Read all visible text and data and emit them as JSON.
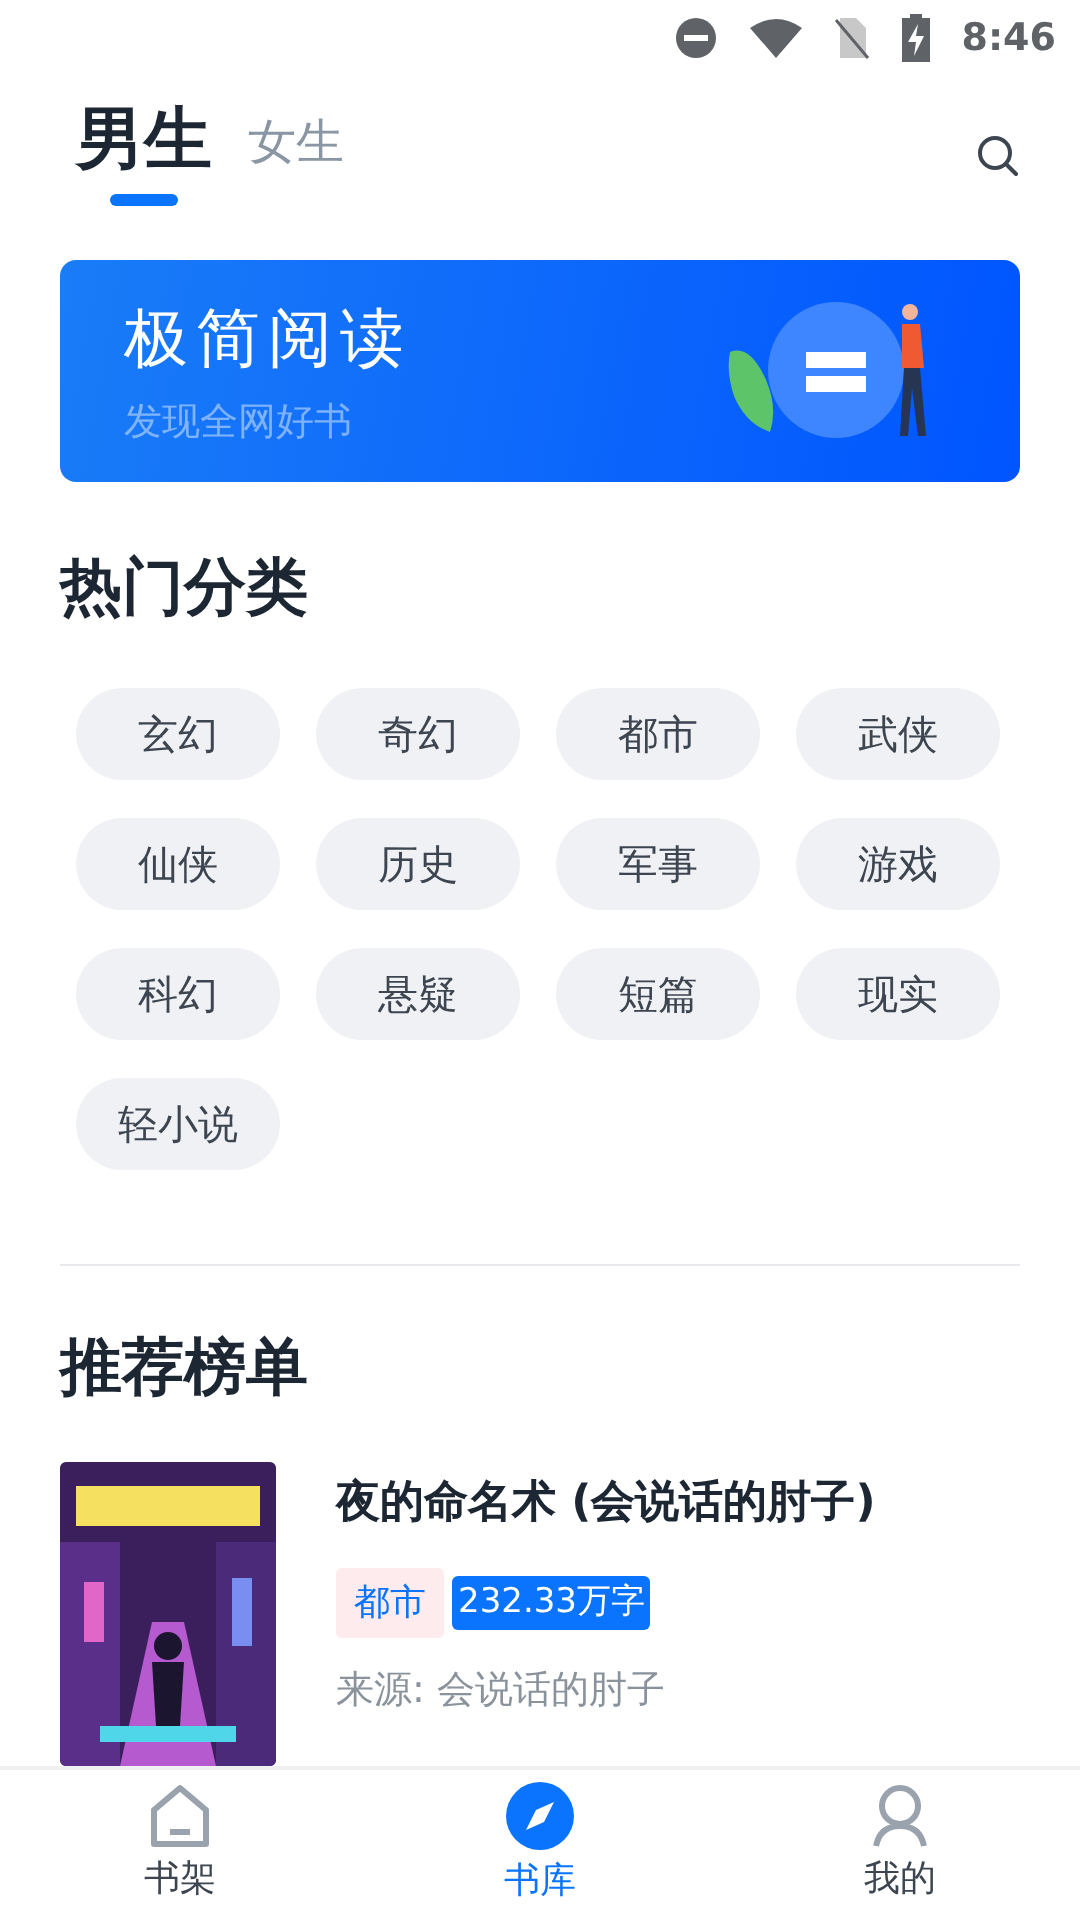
{
  "status_bar": {
    "time": "8:46"
  },
  "tabs": [
    {
      "label": "男生",
      "selected": true
    },
    {
      "label": "女生",
      "selected": false
    }
  ],
  "banner": {
    "title": "极简阅读",
    "subtitle": "发现全网好书"
  },
  "categories": {
    "heading": "热门分类",
    "items": [
      "玄幻",
      "奇幻",
      "都市",
      "武侠",
      "仙侠",
      "历史",
      "军事",
      "游戏",
      "科幻",
      "悬疑",
      "短篇",
      "现实",
      "轻小说"
    ]
  },
  "ranking": {
    "heading": "推荐榜单",
    "books": [
      {
        "title": "夜的命名术 (会说话的肘子)",
        "genre": "都市",
        "word_count": "232.33万字",
        "source": "来源: 会说话的肘子"
      }
    ]
  },
  "bottom_nav": [
    {
      "label": "书架",
      "selected": false
    },
    {
      "label": "书库",
      "selected": true
    },
    {
      "label": "我的",
      "selected": false
    }
  ]
}
